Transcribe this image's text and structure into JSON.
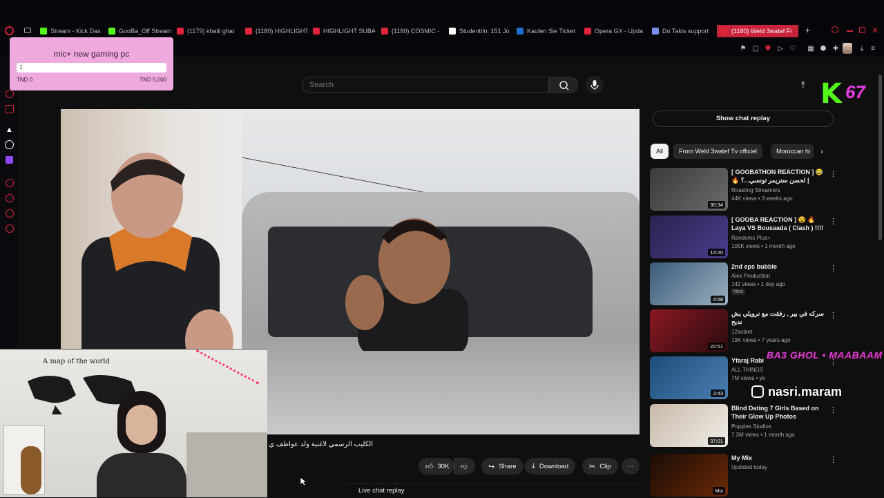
{
  "browser": {
    "tabs": [
      {
        "label": "Stream - Kick Das",
        "icon_color": "#53fc18",
        "icon": "kick-icon"
      },
      {
        "label": "GooBa_Off Stream",
        "icon_color": "#53fc18",
        "icon": "kick-icon"
      },
      {
        "label": "(1179) khalil ghar",
        "icon_color": "#e0243a",
        "icon": "youtube-icon"
      },
      {
        "label": "(1180) HIGHLIGHT",
        "icon_color": "#e0243a",
        "icon": "youtube-icon"
      },
      {
        "label": "HIGHLIGHT SUBA",
        "icon_color": "#e0243a",
        "icon": "youtube-icon"
      },
      {
        "label": "(1180) COSMIC -",
        "icon_color": "#e0243a",
        "icon": "youtube-icon"
      },
      {
        "label": "Student/in: 151 Jo",
        "icon_color": "#ffffff",
        "icon": "site-icon"
      },
      {
        "label": "Kaufen Sie Ticket",
        "icon_color": "#1f6fd1",
        "icon": "site-icon"
      },
      {
        "label": "Opera GX - Upda",
        "icon_color": "#e0243a",
        "icon": "opera-icon"
      },
      {
        "label": "Do Takis support",
        "icon_color": "#7a8df0",
        "icon": "site-icon"
      },
      {
        "label": "(1180) Weld 3watef Fi",
        "icon_color": "#e0243a",
        "icon": "youtube-icon"
      }
    ],
    "new_tab": "+"
  },
  "goal_widget": {
    "title": "mic+ new gaming pc",
    "current": "1",
    "min_label": "TND 0",
    "max_label": "TND 5,000",
    "progress_fraction": 0.0002
  },
  "youtube": {
    "search_placeholder": "Search",
    "video_title": "الكليب الرسمي لأغنية ولد عواطف ي",
    "like_count": "30K",
    "share_label": "Share",
    "download_label": "Download",
    "clip_label": "Clip",
    "more_label": "⋯",
    "live_chat_replay": "Live chat replay",
    "show_chat_replay": "Show chat replay",
    "chips": [
      "All",
      "From Weld 3watef Tv officiel",
      "Moroccan hi"
    ],
    "recommendations": [
      {
        "title": "[ GOOBATHON REACTION ] 😂 🔥 لحسن ستريمر تونسي...؟ | Letaief -...",
        "channel": "Roasting Streamers",
        "meta": "44K views • 3 weeks ago",
        "duration": "30:34",
        "badge": "",
        "thumb_colors": [
          "#3a3a3a",
          "#6b6b6b"
        ]
      },
      {
        "title": "[ GOOBA REACTION ] 😵 🔥 Laya VS Bousaada ( Clash ) !!!!",
        "channel": "Randoms Plus+",
        "meta": "105K views • 1 month ago",
        "duration": "14:20",
        "badge": "",
        "thumb_colors": [
          "#2b2350",
          "#4a3b8a"
        ]
      },
      {
        "title": "2nd eps bubble",
        "channel": "Alex Production",
        "meta": "142 views • 1 day ago",
        "duration": "4:58",
        "badge": "New",
        "thumb_colors": [
          "#3b5b7a",
          "#9bb0c0"
        ]
      },
      {
        "title": "سركه في بير , رفقت مع نرويلي بش ندبح",
        "channel": "12soblet",
        "meta": "19K views • 7 years ago",
        "duration": "22:51",
        "badge": "",
        "thumb_colors": [
          "#8a1822",
          "#2a0b0f"
        ]
      },
      {
        "title": "Yfaraj Rabi",
        "channel": "ALL THINGS",
        "meta": "7M views • ye",
        "duration": "2:43",
        "badge": "",
        "thumb_colors": [
          "#1d4d7a",
          "#4b7fb0"
        ]
      },
      {
        "title": "Blind Dating 7 Girls Based on Their Glow Up Photos",
        "channel": "Poppies Studios",
        "meta": "7.3M views • 1 month ago",
        "duration": "37:01",
        "badge": "",
        "thumb_colors": [
          "#c8b9a8",
          "#f0ede8"
        ]
      },
      {
        "title": "My Mix",
        "channel": "Updated today",
        "meta": "",
        "duration": "Mix",
        "badge": "",
        "thumb_colors": [
          "#1a0b05",
          "#6b2a08"
        ]
      }
    ]
  },
  "overlays": {
    "k_logo": "K",
    "k_number": "67",
    "pink_text": "BA3 GHOL • MAABAAM",
    "handle": "nasri.maram",
    "webcam_wall_text": "A map of the world"
  },
  "colors": {
    "accent": "#d0253a",
    "kick_green": "#53fc18",
    "overlay_pink": "#e23de0",
    "goal_bg": "#eea9dd"
  }
}
